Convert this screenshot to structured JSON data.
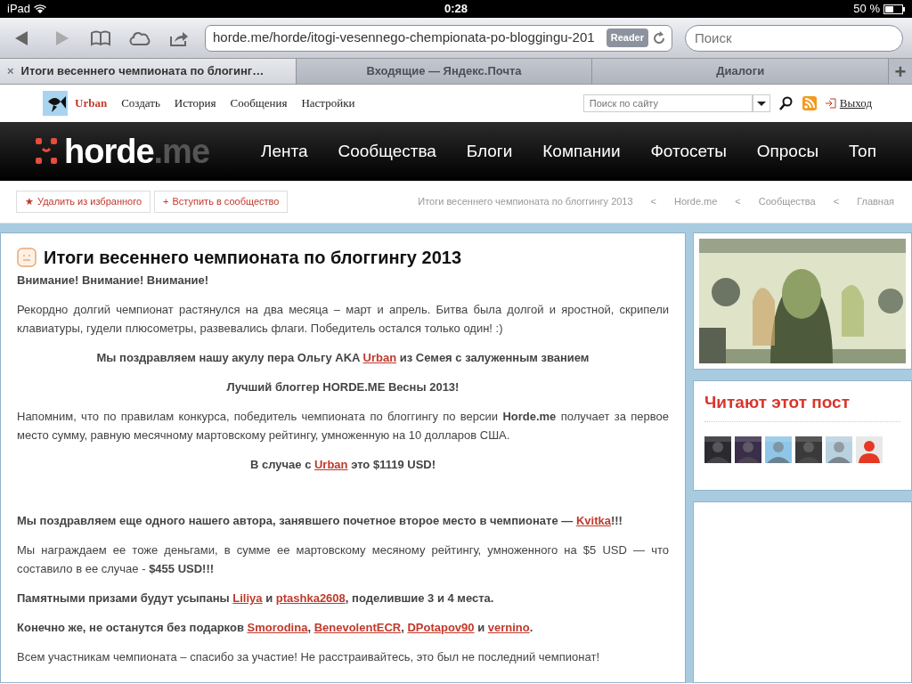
{
  "status_bar": {
    "device": "iPad",
    "time": "0:28",
    "battery": "50 %"
  },
  "browser": {
    "url": "horde.me/horde/itogi-vesennego-chempionata-po-bloggingu-201",
    "reader": "Reader",
    "search_placeholder": "Поиск",
    "tabs": [
      {
        "label": "Итоги весеннего чемпионата по блогинг…",
        "selected": true,
        "close": "×"
      },
      {
        "label": "Входящие — Яндекс.Почта",
        "selected": false
      },
      {
        "label": "Диалоги",
        "selected": false
      }
    ],
    "new_tab": "+"
  },
  "site_bar": {
    "user": "Urban",
    "links": [
      "Создать",
      "История",
      "Сообщения",
      "Настройки"
    ],
    "search_placeholder": "Поиск по сайту",
    "logout": "Выход"
  },
  "main_nav": {
    "logo": "horde",
    "logo_suffix": ".me",
    "items": [
      "Лента",
      "Сообщества",
      "Блоги",
      "Компании",
      "Фотосеты",
      "Опросы",
      "Топ"
    ]
  },
  "actions": [
    {
      "icon": "★",
      "label": "Удалить из избранного"
    },
    {
      "icon": "+",
      "label": "Вступить в сообщество"
    }
  ],
  "breadcrumbs": [
    {
      "label": "Итоги весеннего чемпионата по блоггингу 2013",
      "separator": "<"
    },
    {
      "label": "Horde.me",
      "separator": "<"
    },
    {
      "label": "Сообщества",
      "separator": "<"
    },
    {
      "label": "Главная"
    }
  ],
  "post": {
    "title": "Итоги весеннего чемпионата по блоггингу 2013",
    "paragraphs": [
      {
        "kind": "emphasis",
        "parts": [
          {
            "kind": "text",
            "text": "Внимание! Внимание! Внимание!"
          }
        ]
      },
      {
        "kind": "body",
        "parts": [
          {
            "kind": "text",
            "text": "Рекордно долгий чемпионат растянулся на два месяца – март и апрель. Битва была долгой и яростной, скрипели клавиатуры, гудели плюсометры,  развевались флаги. Победитель  остался только один! :)"
          }
        ]
      },
      {
        "kind": "centered",
        "parts": [
          {
            "kind": "text",
            "text": "Мы поздравляем  нашу акулу пера Ольгу AKA "
          },
          {
            "kind": "link",
            "text": "Urban"
          },
          {
            "kind": "text",
            "text": " из Семея с залуженным званием"
          }
        ]
      },
      {
        "kind": "centered",
        "parts": [
          {
            "kind": "text",
            "text": "Лучший блоггер HORDE.ME Весны 2013!"
          }
        ]
      },
      {
        "kind": "body",
        "parts": [
          {
            "kind": "text",
            "text": "Напомним, что по правилам конкурса, победитель чемпионата по блоггингу по версии "
          },
          {
            "kind": "bold",
            "text": "Horde.me"
          },
          {
            "kind": "text",
            "text": " получает за первое место сумму, равную месячному мартовскому рейтингу, умноженную на 10 долларов США."
          }
        ]
      },
      {
        "kind": "centered",
        "gap_after": true,
        "parts": [
          {
            "kind": "text",
            "text": "В случае с "
          },
          {
            "kind": "link",
            "text": "Urban"
          },
          {
            "kind": "text",
            "text": " это $1119 USD!"
          }
        ]
      },
      {
        "kind": "emphasis",
        "parts": [
          {
            "kind": "text",
            "text": "Мы поздравляем еще одного нашего автора, занявшего почетное второе место в чемпионате — "
          },
          {
            "kind": "link",
            "text": "Kvitka"
          },
          {
            "kind": "text",
            "text": "!!!"
          }
        ]
      },
      {
        "kind": "body",
        "parts": [
          {
            "kind": "text",
            "text": "Мы награждаем ее тоже деньгами, в сумме ее мартовскому месяному рейтингу, умноженного на $5 USD — что составило в ее случае - "
          },
          {
            "kind": "bold",
            "text": "$455 USD!!!"
          }
        ]
      },
      {
        "kind": "emphasis",
        "parts": [
          {
            "kind": "text",
            "text": "Памятными призами будут усыпаны  "
          },
          {
            "kind": "link",
            "text": "Liliya"
          },
          {
            "kind": "text",
            "text": " и "
          },
          {
            "kind": "link",
            "text": "ptashka2608"
          },
          {
            "kind": "text",
            "text": ", поделившие 3 и 4 места."
          }
        ]
      },
      {
        "kind": "emphasis",
        "parts": [
          {
            "kind": "text",
            "text": "Конечно же, не останутся без подарков "
          },
          {
            "kind": "link",
            "text": "Smorodina"
          },
          {
            "kind": "text",
            "text": ", "
          },
          {
            "kind": "link",
            "text": "BenevolentECR"
          },
          {
            "kind": "text",
            "text": ", "
          },
          {
            "kind": "link",
            "text": "DPotapov90"
          },
          {
            "kind": "text",
            "text": " и "
          },
          {
            "kind": "link",
            "text": "vernino"
          },
          {
            "kind": "text",
            "text": "."
          }
        ]
      },
      {
        "kind": "body",
        "parts": [
          {
            "kind": "text",
            "text": "Всем участникам чемпионата – спасибо за участие! Не расстраивайтесь, это был не последний чемпионат!"
          }
        ]
      }
    ]
  },
  "sidebar": {
    "banner": {
      "kind": "picture"
    },
    "readers_title": "Читают этот пост",
    "readers": [
      {
        "kind": "picture",
        "color": "#2a2a30"
      },
      {
        "kind": "picture",
        "color": "#3a2e4a"
      },
      {
        "kind": "picture",
        "color": "#8fc6e8"
      },
      {
        "kind": "picture",
        "color": "#3a3a3a"
      },
      {
        "kind": "picture",
        "color": "#b9d2e0"
      },
      {
        "kind": "silhouette",
        "color": "#e8e8e8"
      }
    ]
  }
}
